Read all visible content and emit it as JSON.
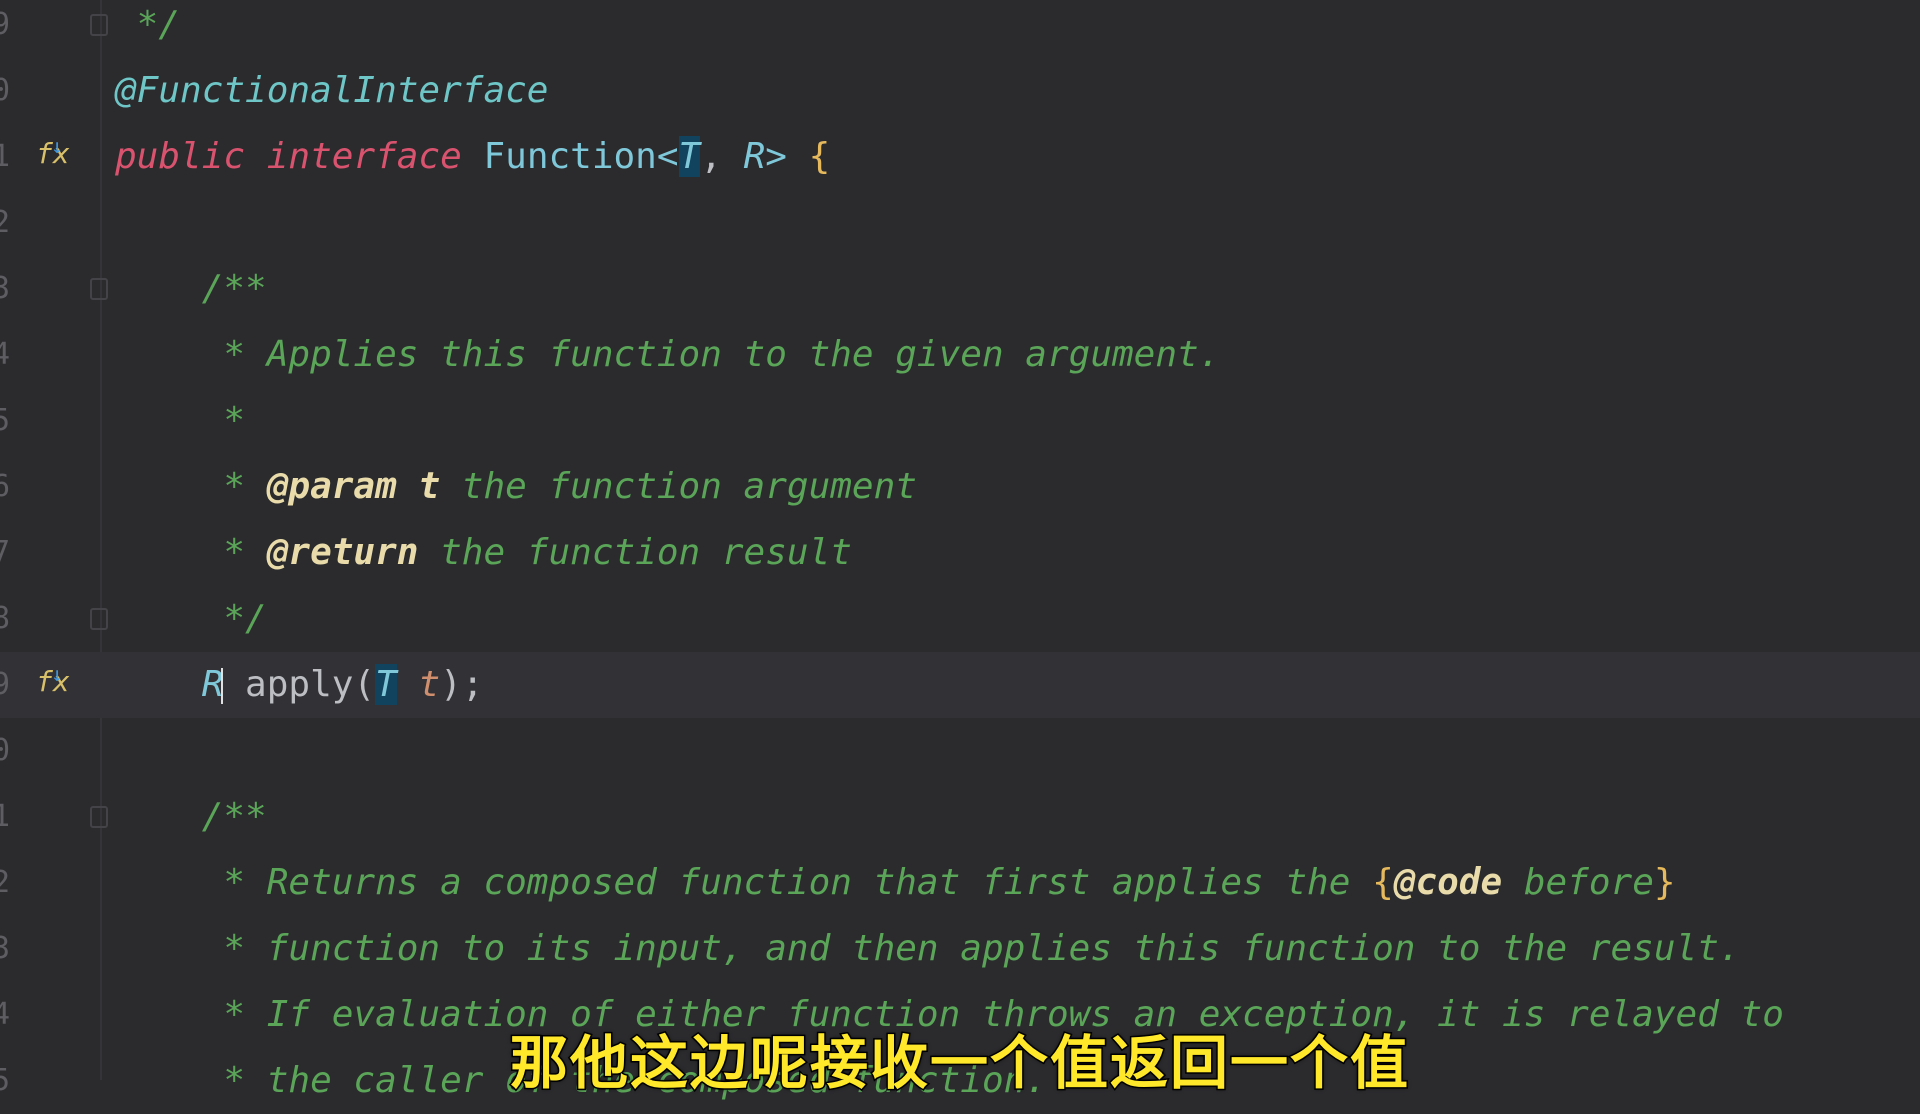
{
  "editor": {
    "colors": {
      "background": "#2b2b2e",
      "comment": "#5aa558",
      "keyword": "#d9536f",
      "type": "#7fc8da",
      "javadoc_tag": "#e9dcaa",
      "annotation": "#6ec6c6",
      "brace": "#e5b95c"
    },
    "lines": [
      {
        "num": "9",
        "fold": true,
        "tokens": [
          {
            "t": " */",
            "c": "cm"
          }
        ]
      },
      {
        "num": "0",
        "tokens": [
          {
            "t": "@FunctionalInterface",
            "c": "an"
          }
        ]
      },
      {
        "num": "1",
        "gutter": "implementations-icon",
        "tokens": [
          {
            "t": "public interface ",
            "c": "kw"
          },
          {
            "t": "Function<",
            "c": "ty"
          },
          {
            "t": "T",
            "c": "tp hl"
          },
          {
            "t": ", ",
            "c": "pl"
          },
          {
            "t": "R",
            "c": "tp"
          },
          {
            "t": "> ",
            "c": "ty"
          },
          {
            "t": "{",
            "c": "br"
          }
        ]
      },
      {
        "num": "2",
        "tokens": []
      },
      {
        "num": "3",
        "fold": true,
        "tokens": [
          {
            "t": "    /**",
            "c": "cm"
          }
        ]
      },
      {
        "num": "4",
        "tokens": [
          {
            "t": "     * Applies this function to the given argument.",
            "c": "cm"
          }
        ]
      },
      {
        "num": "5",
        "tokens": [
          {
            "t": "     *",
            "c": "cm"
          }
        ]
      },
      {
        "num": "6",
        "tokens": [
          {
            "t": "     * ",
            "c": "cm"
          },
          {
            "t": "@param",
            "c": "tag"
          },
          {
            "t": " t",
            "c": "tag"
          },
          {
            "t": " the function argument",
            "c": "cm"
          }
        ]
      },
      {
        "num": "7",
        "tokens": [
          {
            "t": "     * ",
            "c": "cm"
          },
          {
            "t": "@return",
            "c": "tag"
          },
          {
            "t": " the function result",
            "c": "cm"
          }
        ]
      },
      {
        "num": "8",
        "fold": true,
        "tokens": [
          {
            "t": "     */",
            "c": "cm"
          }
        ]
      },
      {
        "num": "9",
        "gutter": "implementations-icon",
        "current": true,
        "tokens": [
          {
            "t": "    R",
            "c": "tp"
          },
          {
            "t": "",
            "c": "caret"
          },
          {
            "t": " apply(",
            "c": "pl"
          },
          {
            "t": "T",
            "c": "tp hl"
          },
          {
            "t": " t",
            "c": "pa"
          },
          {
            "t": ");",
            "c": "pl"
          }
        ]
      },
      {
        "num": "0",
        "tokens": []
      },
      {
        "num": "1",
        "fold": true,
        "tokens": [
          {
            "t": "    /**",
            "c": "cm"
          }
        ]
      },
      {
        "num": "2",
        "tokens": [
          {
            "t": "     * Returns a composed function that first applies the ",
            "c": "cm"
          },
          {
            "t": "{",
            "c": "br"
          },
          {
            "t": "@code",
            "c": "tag"
          },
          {
            "t": " before",
            "c": "cm"
          },
          {
            "t": "}",
            "c": "br"
          }
        ]
      },
      {
        "num": "3",
        "tokens": [
          {
            "t": "     * function to its input, and then applies this function to the result.",
            "c": "cm"
          }
        ]
      },
      {
        "num": "4",
        "tokens": [
          {
            "t": "     * If evaluation of either function throws an exception, it is relayed to",
            "c": "cm"
          }
        ]
      },
      {
        "num": "5",
        "tokens": [
          {
            "t": "     * the caller of the composed function.",
            "c": "cm"
          }
        ]
      }
    ]
  },
  "subtitle": "那他这边呢接收一个值返回一个值"
}
